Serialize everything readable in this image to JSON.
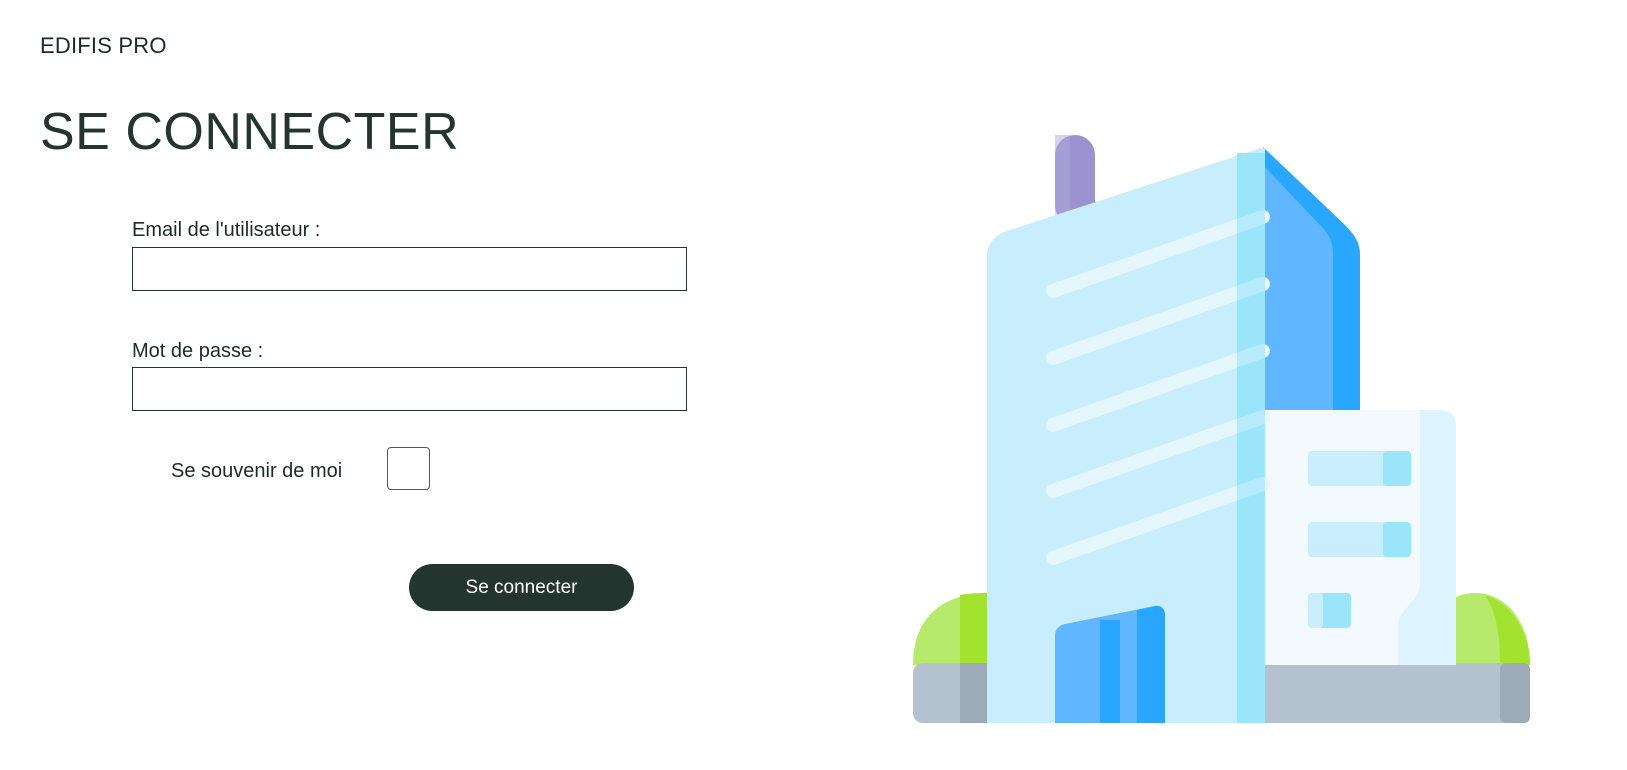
{
  "header": {
    "brand": "EDIFIS PRO",
    "title": "SE CONNECTER"
  },
  "form": {
    "email_label": "Email de l'utilisateur :",
    "email_value": "",
    "password_label": "Mot de passe :",
    "password_value": "",
    "remember_label": "Se souvenir de moi",
    "remember_checked": false,
    "submit_label": "Se connecter"
  },
  "illustration": {
    "icon": "office-building-icon"
  },
  "colors": {
    "primary": "#243530",
    "building_light": "#c8edfc",
    "building_blue": "#60b6ff",
    "building_dark_blue": "#29a7ff",
    "bush_green": "#b7ea6c",
    "ground": "#b4c2cf"
  }
}
